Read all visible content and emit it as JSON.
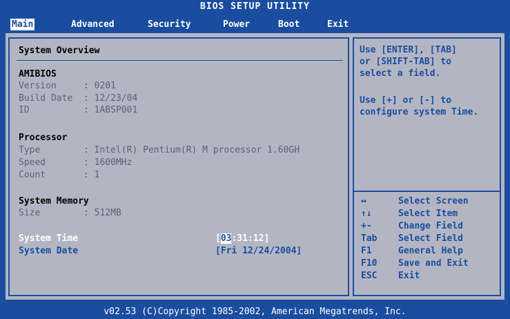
{
  "window": {
    "title": "BIOS SETUP UTILITY"
  },
  "tabs": [
    "Main",
    "Advanced",
    "Security",
    "Power",
    "Boot",
    "Exit"
  ],
  "overview": {
    "heading": "System Overview",
    "amibios": {
      "heading": "AMIBIOS",
      "version_label": "Version",
      "version_value": ": 0201",
      "build_label": "Build Date",
      "build_value": ": 12/23/04",
      "id_label": "ID",
      "id_value": ": 1ABSP001"
    },
    "processor": {
      "heading": "Processor",
      "type_label": "Type",
      "type_value": ": Intel(R) Pentium(R) M processor 1.60GH",
      "speed_label": "Speed",
      "speed_value": ": 1600MHz",
      "count_label": "Count",
      "count_value": ": 1"
    },
    "memory": {
      "heading": "System Memory",
      "size_label": "Size",
      "size_value": ": 512MB"
    },
    "time": {
      "label": "System Time",
      "open": "[",
      "hour": "03",
      "rest": ":31:12]"
    },
    "date": {
      "label": "System Date",
      "value": "[Fri 12/24/2004]"
    }
  },
  "help": {
    "lines": [
      "Use [ENTER], [TAB]",
      "or [SHIFT-TAB] to",
      "select a field."
    ],
    "lines2": [
      "Use [+] or [-] to",
      "configure system Time."
    ]
  },
  "keys": [
    {
      "key": "↔",
      "action": "Select Screen"
    },
    {
      "key": "↑↓",
      "action": "Select Item"
    },
    {
      "key": "+-",
      "action": "Change Field"
    },
    {
      "key": "Tab",
      "action": "Select Field"
    },
    {
      "key": "F1",
      "action": "General Help"
    },
    {
      "key": "F10",
      "action": "Save and Exit"
    },
    {
      "key": "ESC",
      "action": "Exit"
    }
  ],
  "footer": {
    "text": "v02.53 (C)Copyright 1985-2002, American Megatrends, Inc."
  },
  "colors": {
    "blue": "#1a4da0",
    "panel": "#b3b6c2",
    "white": "#ffffff",
    "dim": "#5a6278"
  }
}
